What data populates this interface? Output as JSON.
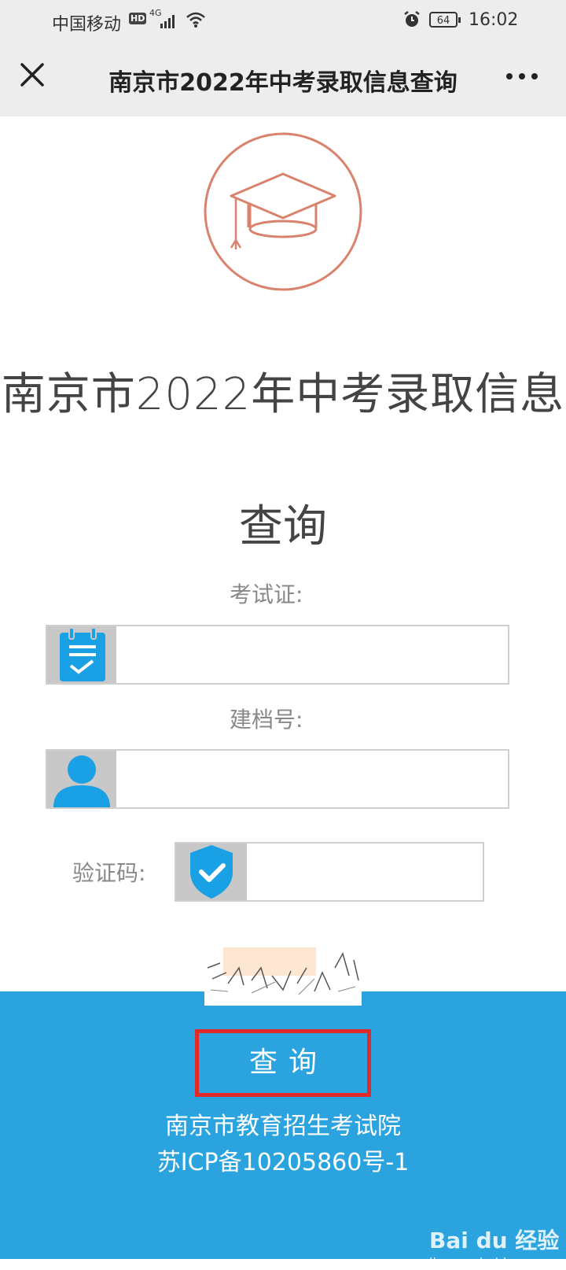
{
  "status_bar": {
    "carrier": "中国移动",
    "hd_badge": "HD",
    "network": "4G",
    "battery": "64",
    "time": "16:02"
  },
  "nav": {
    "title": "南京市2022年中考录取信息查询"
  },
  "page": {
    "title_line1": "南京市2022年中考录取信息",
    "title_line2": "查询"
  },
  "form": {
    "exam_id_label": "考试证:",
    "file_no_label": "建档号:",
    "captcha_label": "验证码:"
  },
  "footer": {
    "query_button": "查询",
    "org": "南京市教育招生考试院",
    "icp": "苏ICP备10205860号-1"
  },
  "watermark": {
    "brand": "Bai du 经验",
    "url": "jingyan.baidu.com"
  },
  "colors": {
    "accent_blue": "#2aa3de",
    "logo_red": "#d9826e",
    "highlight_red": "#e02a2a",
    "icon_blue": "#1aa0e4"
  }
}
